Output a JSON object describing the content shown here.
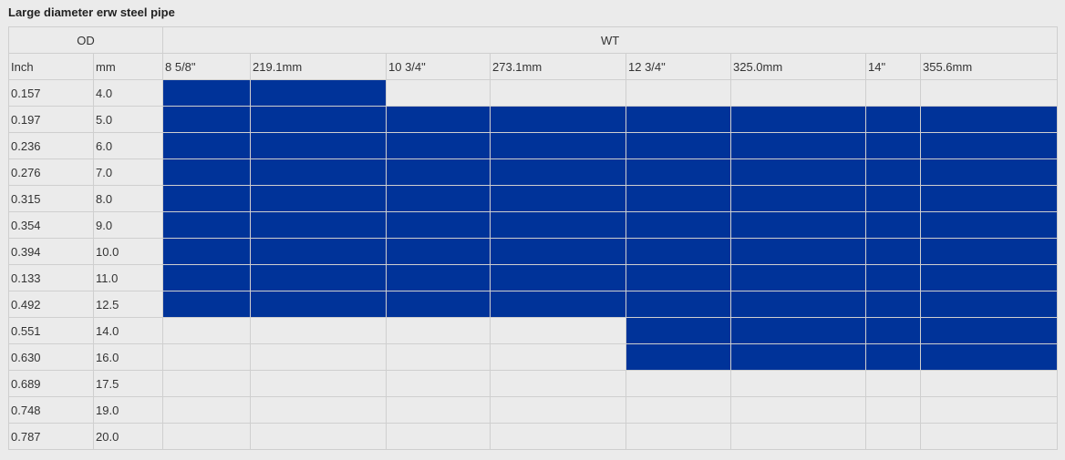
{
  "title": "Large diameter erw steel pipe",
  "headers": {
    "od": "OD",
    "wt": "WT",
    "inch": "Inch",
    "mm": "mm",
    "sizes": [
      "8 5/8\"",
      "219.1mm",
      "10 3/4\"",
      "273.1mm",
      "12 3/4\"",
      "325.0mm",
      "14\"",
      "355.6mm"
    ]
  },
  "colors": {
    "available": "#003399",
    "empty": "#ebebeb",
    "border": "#cfcfcf"
  },
  "rows": [
    {
      "inch": "0.157",
      "mm": "4.0",
      "available": [
        true,
        true,
        false,
        false,
        false,
        false,
        false,
        false
      ]
    },
    {
      "inch": "0.197",
      "mm": "5.0",
      "available": [
        true,
        true,
        true,
        true,
        true,
        true,
        true,
        true
      ]
    },
    {
      "inch": "0.236",
      "mm": "6.0",
      "available": [
        true,
        true,
        true,
        true,
        true,
        true,
        true,
        true
      ]
    },
    {
      "inch": "0.276",
      "mm": "7.0",
      "available": [
        true,
        true,
        true,
        true,
        true,
        true,
        true,
        true
      ]
    },
    {
      "inch": "0.315",
      "mm": "8.0",
      "available": [
        true,
        true,
        true,
        true,
        true,
        true,
        true,
        true
      ]
    },
    {
      "inch": "0.354",
      "mm": "9.0",
      "available": [
        true,
        true,
        true,
        true,
        true,
        true,
        true,
        true
      ]
    },
    {
      "inch": "0.394",
      "mm": "10.0",
      "available": [
        true,
        true,
        true,
        true,
        true,
        true,
        true,
        true
      ]
    },
    {
      "inch": "0.133",
      "mm": "11.0",
      "available": [
        true,
        true,
        true,
        true,
        true,
        true,
        true,
        true
      ]
    },
    {
      "inch": "0.492",
      "mm": "12.5",
      "available": [
        true,
        true,
        true,
        true,
        true,
        true,
        true,
        true
      ]
    },
    {
      "inch": "0.551",
      "mm": "14.0",
      "available": [
        false,
        false,
        false,
        false,
        true,
        true,
        true,
        true
      ]
    },
    {
      "inch": "0.630",
      "mm": "16.0",
      "available": [
        false,
        false,
        false,
        false,
        true,
        true,
        true,
        true
      ]
    },
    {
      "inch": "0.689",
      "mm": "17.5",
      "available": [
        false,
        false,
        false,
        false,
        false,
        false,
        false,
        false
      ]
    },
    {
      "inch": "0.748",
      "mm": "19.0",
      "available": [
        false,
        false,
        false,
        false,
        false,
        false,
        false,
        false
      ]
    },
    {
      "inch": "0.787",
      "mm": "20.0",
      "available": [
        false,
        false,
        false,
        false,
        false,
        false,
        false,
        false
      ]
    }
  ]
}
